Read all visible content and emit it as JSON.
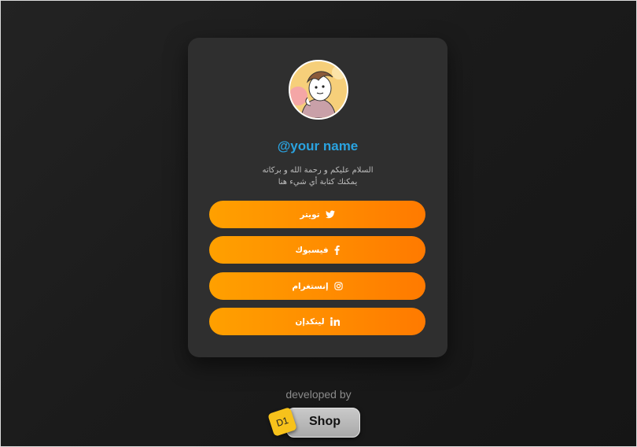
{
  "profile": {
    "username": "@your name",
    "bio_line1": "السلام عليكم و رحمة الله و بركاته",
    "bio_line2": "يمكنك كتابة أي شيء هنا"
  },
  "links": [
    {
      "label": "تويتر",
      "icon": "twitter-icon"
    },
    {
      "label": "فيسبوك",
      "icon": "facebook-icon"
    },
    {
      "label": "إنستغرام",
      "icon": "instagram-icon"
    },
    {
      "label": "لينكدإن",
      "icon": "linkedin-icon"
    }
  ],
  "footer": {
    "developed_by": "developed by",
    "brand_badge": "D1",
    "brand_name": "Shop"
  },
  "colors": {
    "accent_orange": "#ff8c00",
    "username_blue": "#2aa3e0",
    "card_bg": "#2f2f2f",
    "page_bg": "#1b1b1b"
  }
}
